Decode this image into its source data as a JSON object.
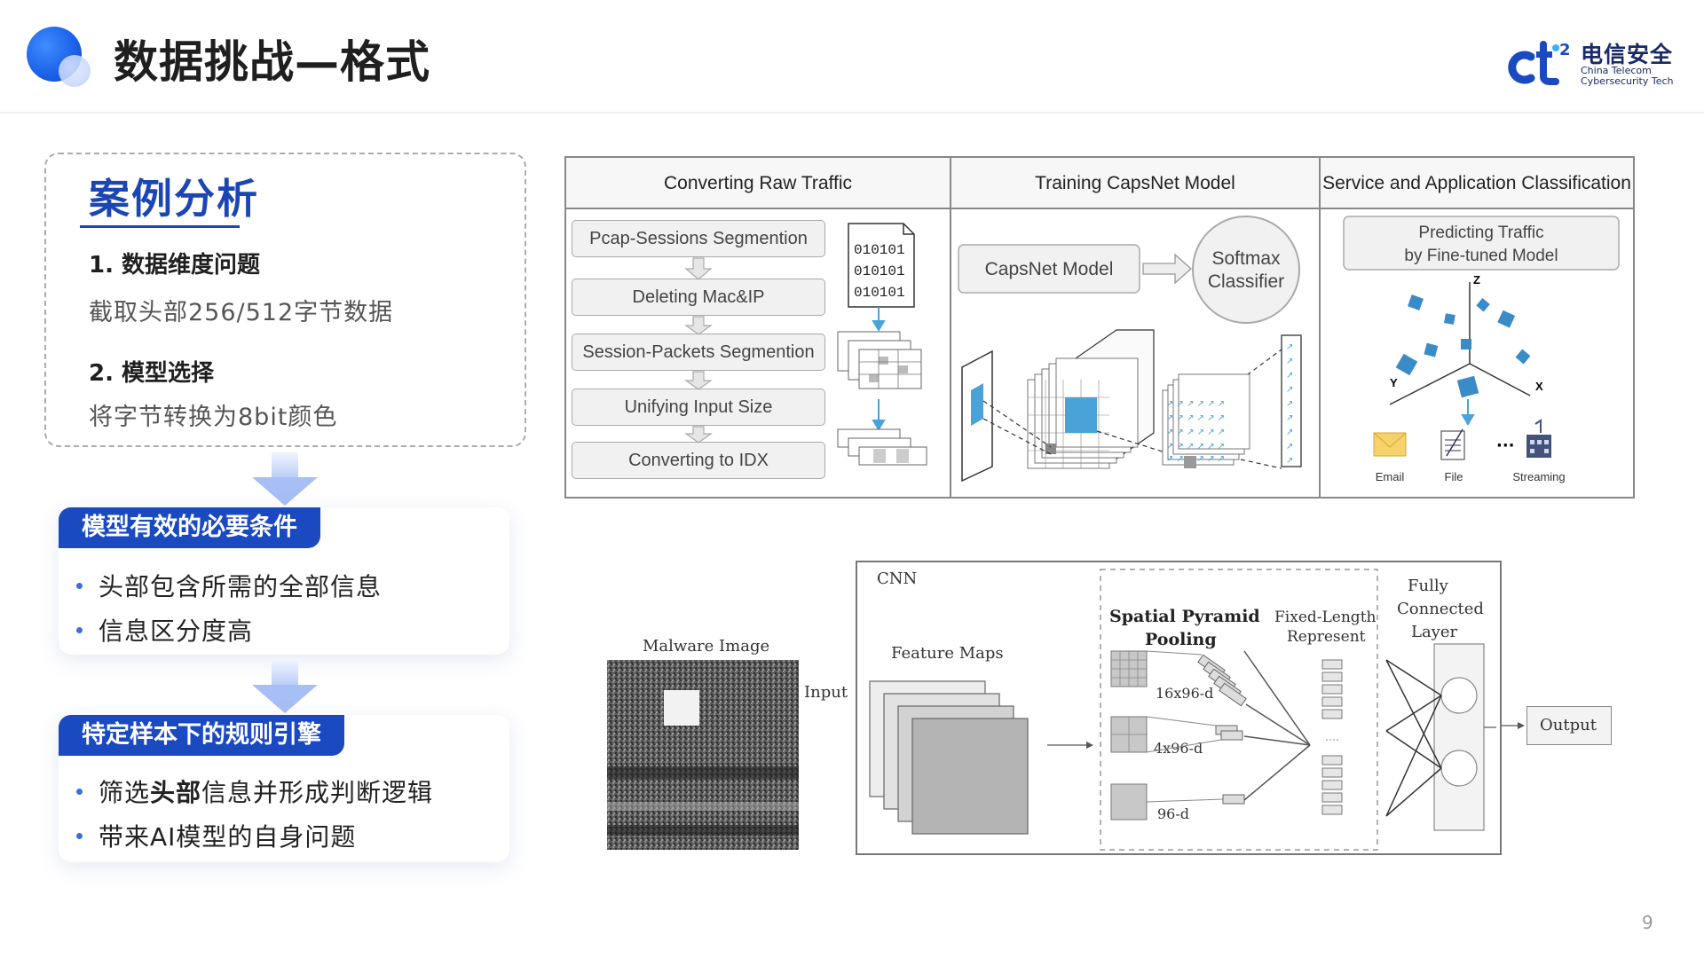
{
  "header": {
    "title": "数据挑战—格式",
    "logo_cn": "电信安全",
    "logo_en_line1": "China Telecom",
    "logo_en_line2": "Cybersecurity Tech",
    "logo_mark_text": "ct",
    "logo_superscript": "2"
  },
  "case": {
    "title": "案例分析",
    "item1_heading": "1. 数据维度问题",
    "item1_text": "截取头部256/512字节数据",
    "item2_heading": "2. 模型选择",
    "item2_text": "将字节转换为8bit颜色"
  },
  "card1": {
    "tag": "模型有效的必要条件",
    "items": [
      "头部包含所需的全部信息",
      "信息区分度高"
    ]
  },
  "card2": {
    "tag": "特定样本下的规则引擎",
    "item1_prefix": "筛选",
    "item1_bold": "头部",
    "item1_suffix": "信息并形成判断逻辑",
    "item2": "带来AI模型的自身问题"
  },
  "capsnet_figure": {
    "col1_header": "Converting Raw Traffic",
    "col2_header": "Training CapsNet Model",
    "col3_header": "Service and Application Classification",
    "steps": [
      "Pcap-Sessions Segmention",
      "Deleting Mac&IP",
      "Session-Packets Segmention",
      "Unifying Input Size",
      "Converting to IDX"
    ],
    "binary_lines": [
      "010101",
      "010101",
      "010101"
    ],
    "capsnet_model": "CapsNet Model",
    "softmax_line1": "Softmax",
    "softmax_line2": "Classifier",
    "predict_line1": "Predicting Traffic",
    "predict_line2": "by Fine-tuned Model",
    "axis_z": "Z",
    "axis_y": "Y",
    "axis_x": "X",
    "icon_email": "Email",
    "icon_file": "File",
    "icon_dots": "···",
    "icon_streaming": "Streaming"
  },
  "cnn_figure": {
    "cnn_label": "CNN",
    "malware_image": "Malware Image",
    "input": "Input",
    "feature_maps": "Feature Maps",
    "spp_line1": "Spatial Pyramid",
    "spp_line2": "Pooling",
    "dim1": "16x96-d",
    "dim2": "4x96-d",
    "dim3": "96-d",
    "fixed_line1": "Fixed-Length",
    "fixed_line2": "Represent",
    "fc_line1": "Fully",
    "fc_line2": "Connected",
    "fc_line3": "Layer",
    "output": "Output"
  },
  "page_number": "9",
  "colors": {
    "accent": "#1a49c0",
    "title_blue": "#1b46b4",
    "figure_blue": "#4aa3d8"
  }
}
